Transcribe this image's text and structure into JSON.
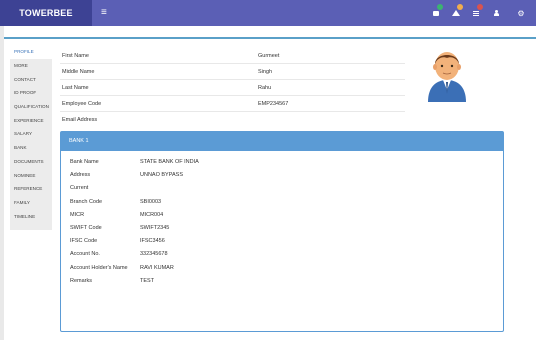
{
  "brand": "TOWERBEE",
  "menu_glyph": "≡",
  "nav": {
    "icons": [
      {
        "name": "mail-icon",
        "badge": "",
        "badge_color": "#3cb371"
      },
      {
        "name": "bell-icon",
        "badge": "",
        "badge_color": "#f0ad4e"
      },
      {
        "name": "tasks-icon",
        "badge": "",
        "badge_color": "#d9534f"
      },
      {
        "name": "user-icon"
      },
      {
        "name": "settings-icon"
      }
    ]
  },
  "sidebar": {
    "tabs": [
      "PROFILE",
      "MORE",
      "CONTACT",
      "ID PROOF",
      "QUALIFICATION",
      "EXPERIENCE",
      "SALARY",
      "BANK",
      "DOCUMENTS",
      "NOMINEE",
      "REFERENCE",
      "FAMILY",
      "TIMELINE"
    ]
  },
  "profile": {
    "first_name_label": "First Name",
    "first_name_value": "Gurmeet",
    "middle_name_label": "Middle Name",
    "middle_name_value": "Singh",
    "last_name_label": "Last Name",
    "last_name_value": "Rahu",
    "employee_code_label": "Employee Code",
    "employee_code_value": "EMP234567",
    "email_label": "Email Address",
    "email_value": ""
  },
  "bank": {
    "title": "BANK 1",
    "rows": [
      {
        "label": "Bank Name",
        "value": "STATE BANK OF INDIA"
      },
      {
        "label": "Address",
        "value": "UNNAO BYPASS"
      },
      {
        "label": "Current",
        "value": ""
      },
      {
        "label": "Branch Code",
        "value": "SBI0003"
      },
      {
        "label": "MICR",
        "value": "MICR004"
      },
      {
        "label": "SWIFT Code",
        "value": "SWIFT2345"
      },
      {
        "label": "IFSC Code",
        "value": "IFSC3456"
      },
      {
        "label": "Account No.",
        "value": "332345678"
      },
      {
        "label": "Account Holder's Name",
        "value": "RAVI KUMAR"
      },
      {
        "label": "Remarks",
        "value": "TEST"
      }
    ]
  },
  "colors": {
    "topbar": "#5b5fb5",
    "brand_bg": "#3d4294",
    "accent": "#5b9bd5"
  }
}
